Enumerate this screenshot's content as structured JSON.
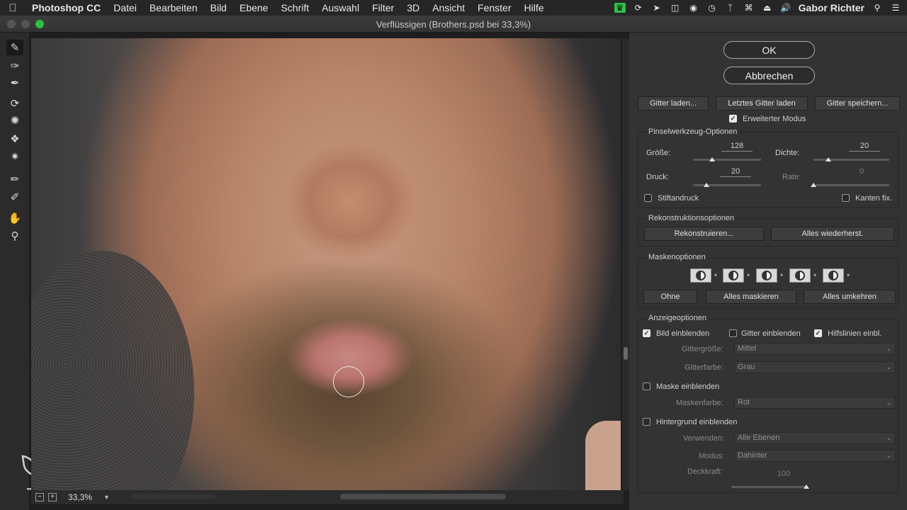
{
  "menubar": {
    "app": "Photoshop CC",
    "items": [
      "Datei",
      "Bearbeiten",
      "Bild",
      "Ebene",
      "Schrift",
      "Auswahl",
      "Filter",
      "3D",
      "Ansicht",
      "Fenster",
      "Hilfe"
    ],
    "user": "Gabor Richter"
  },
  "window": {
    "title": "Verflüssigen (Brothers.psd bei 33,3%)"
  },
  "status": {
    "zoom": "33,3%"
  },
  "panel": {
    "ok": "OK",
    "cancel": "Abbrechen",
    "mesh_load": "Gitter laden...",
    "mesh_last": "Letztes Gitter laden",
    "mesh_save": "Gitter speichern...",
    "advanced_mode": "Erweiterter Modus",
    "brush_title": "Pinselwerkzeug-Optionen",
    "size_label": "Größe:",
    "size_value": "128",
    "density_label": "Dichte:",
    "density_value": "20",
    "pressure_label": "Druck:",
    "pressure_value": "20",
    "rate_label": "Rate:",
    "rate_value": "0",
    "stylus": "Stiftandruck",
    "pin_edges": "Kanten fix.",
    "recon_title": "Rekonstruktionsoptionen",
    "reconstruct": "Rekonstruieren...",
    "restore_all": "Alles wiederherst.",
    "mask_title": "Maskenoptionen",
    "mask_none": "Ohne",
    "mask_all": "Alles maskieren",
    "mask_invert": "Alles umkehren",
    "view_title": "Anzeigeoptionen",
    "show_image": "Bild einblenden",
    "show_mesh": "Gitter einblenden",
    "show_guides": "Hilfslinien einbl.",
    "mesh_size_label": "Gittergröße:",
    "mesh_size_value": "Mittel",
    "mesh_color_label": "Gitterfarbe:",
    "mesh_color_value": "Grau",
    "show_mask": "Maske einblenden",
    "mask_color_label": "Maskenfarbe:",
    "mask_color_value": "Rot",
    "show_backdrop": "Hintergrund einblenden",
    "use_label": "Verwenden:",
    "use_value": "Alle Ebenen",
    "mode_label": "Modus:",
    "mode_value": "Dahinter",
    "opacity_label": "Deckkraft:",
    "opacity_value": "100"
  },
  "sliders": {
    "size": 0.28,
    "density": 0.2,
    "pressure": 0.2,
    "rate": 0.0,
    "opacity": 1.0
  },
  "checkboxes": {
    "advanced_mode": true,
    "stylus": false,
    "pin_edges": false,
    "show_image": true,
    "show_mesh": false,
    "show_guides": true,
    "show_mask": false,
    "show_backdrop": false
  },
  "colors": {
    "panel_bg": "#333333",
    "accent_traffic": "#2fbf46"
  }
}
